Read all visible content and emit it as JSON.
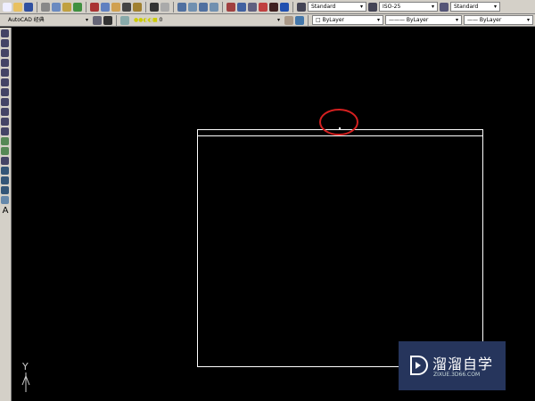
{
  "toolbar": {
    "workspace": "AutoCAD 经典",
    "layer": "0",
    "text_style": "Standard",
    "dim_style": "ISO-25",
    "table_style": "Standard",
    "color": "ByLayer",
    "linetype": "ByLayer",
    "lineweight": "ByLayer"
  },
  "ucs": {
    "y_label": "Y"
  },
  "left_toolbar": {
    "text_tool": "A"
  },
  "watermark": {
    "title": "溜溜自学",
    "url": "ZIXUE.3D66.COM"
  },
  "colors": {
    "annotation": "#d42020",
    "accent": "#26355c"
  }
}
